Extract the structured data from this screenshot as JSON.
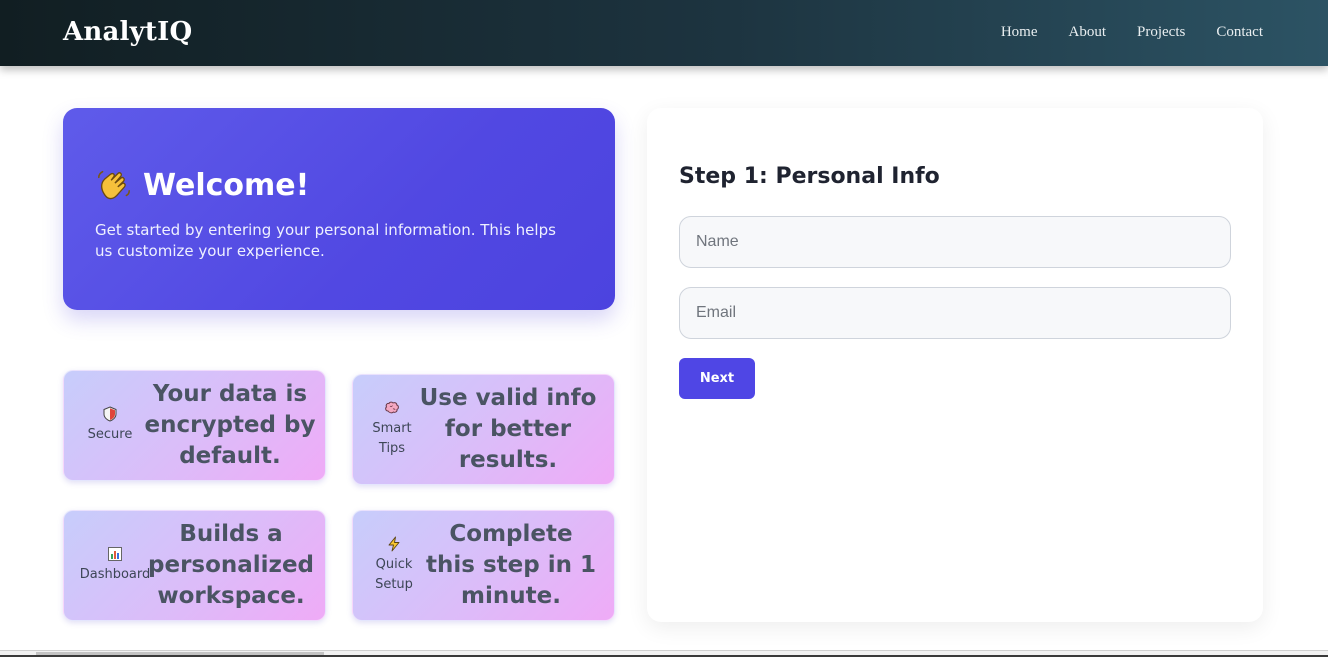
{
  "navbar": {
    "brand": "AnalytIQ",
    "links": [
      "Home",
      "About",
      "Projects",
      "Contact"
    ]
  },
  "welcome": {
    "icon": "waving-hand-icon",
    "heading": "Welcome!",
    "text": "Get started by entering your personal information. This helps us customize your experience."
  },
  "tiles": [
    {
      "icon": "shield-icon",
      "label_lines": [
        "Secure"
      ],
      "text": "Your data is encrypted by default."
    },
    {
      "icon": "brain-icon",
      "label_lines": [
        "Smart",
        "Tips"
      ],
      "text": "Use valid info for better results."
    },
    {
      "icon": "bar-chart-icon",
      "label_lines": [
        "Dashboard"
      ],
      "text": "Builds a personalized workspace."
    },
    {
      "icon": "lightning-icon",
      "label_lines": [
        "Quick",
        "Setup"
      ],
      "text": "Complete this step in 1 minute."
    }
  ],
  "form": {
    "title": "Step 1: Personal Info",
    "name_placeholder": "Name",
    "email_placeholder": "Email",
    "next_label": "Next"
  },
  "colors": {
    "nav_start": "#111e22",
    "nav_end": "#2c5364",
    "accent": "#4f46e5"
  }
}
